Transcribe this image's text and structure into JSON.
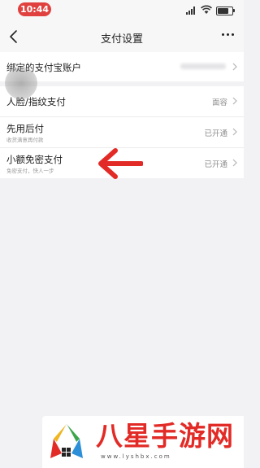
{
  "status_bar": {
    "time": "10:44"
  },
  "header": {
    "title": "支付设置"
  },
  "settings": [
    {
      "label": "绑定的支付宝账户",
      "sub": "",
      "value": "",
      "masked": true
    },
    {
      "label": "人脸/指纹支付",
      "sub": "",
      "value": "面容",
      "masked": false
    },
    {
      "label": "先用后付",
      "sub": "收货满意再付款",
      "value": "已开通",
      "masked": false
    },
    {
      "label": "小额免密支付",
      "sub": "免密支付，快人一步",
      "value": "已开通",
      "masked": false
    }
  ],
  "watermark": {
    "title": "八星手游网",
    "url": "www.lyshbx.com"
  },
  "colors": {
    "accent_red": "#e22b26",
    "time_pill": "#e0413f"
  }
}
